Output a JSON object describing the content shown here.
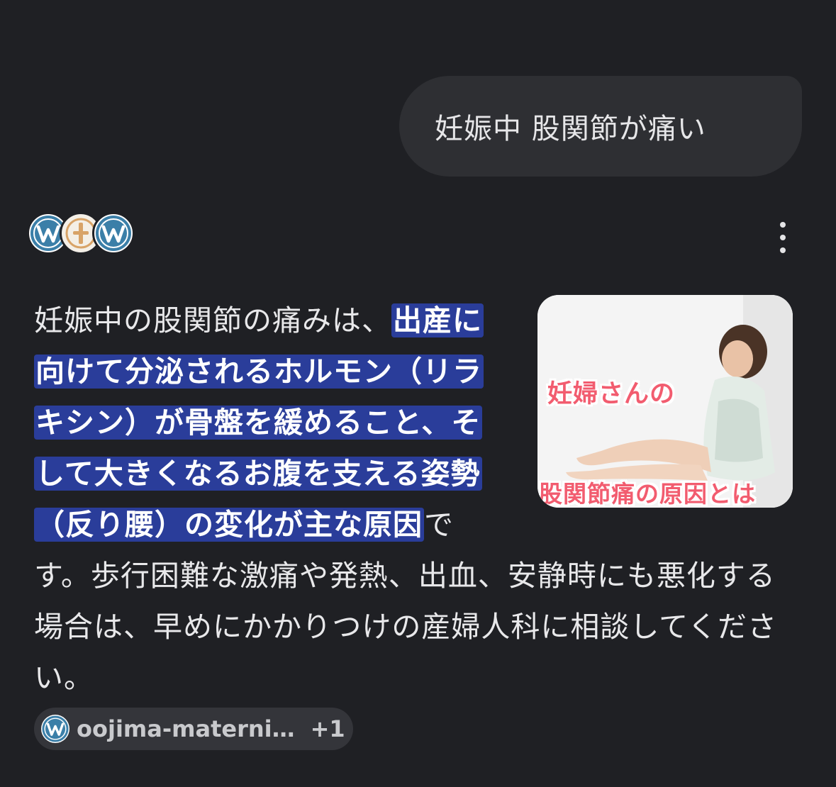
{
  "query": {
    "text": "妊娠中 股関節が痛い"
  },
  "sources": {
    "favicons": [
      "wordpress-icon",
      "clinic-logo-icon",
      "wordpress-icon"
    ],
    "menu_icon": "more-vert-icon"
  },
  "answer": {
    "intro": "妊娠中の股関節の痛みは、",
    "highlight": "出産に向けて分泌されるホルモン（リラキシン）が骨盤を緩めること、そして大きくなるお腹を支える姿勢（反り腰）の変化が主な原因",
    "rest": "です。歩行困難な激痛や発熱、出血、安静時にも悪化する場合は、早めにかかりつけの産婦人科に相談してください。",
    "highlight_color": "#2a3d9a"
  },
  "thumbnail": {
    "line1": "妊婦さんの",
    "line2": "股関節痛の原因とは",
    "text_color": "#f25c6f"
  },
  "citation": {
    "label": "oojima-materni…",
    "count": "+1"
  }
}
